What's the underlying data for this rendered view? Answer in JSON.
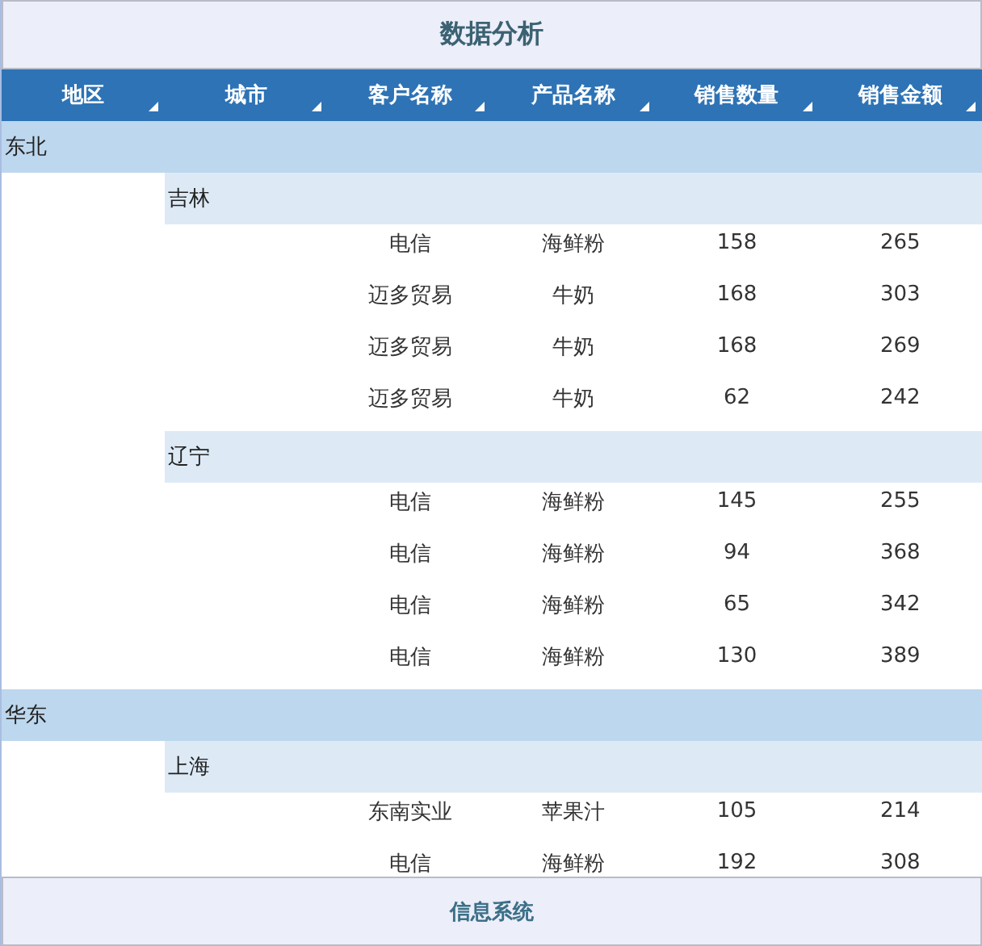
{
  "title": "数据分析",
  "columns": [
    "地区",
    "城市",
    "客户名称",
    "产品名称",
    "销售数量",
    "销售金额"
  ],
  "regions": [
    {
      "name": "东北",
      "children": [
        {
          "name": "吉林",
          "rows": [
            [
              "电信",
              "海鲜粉",
              "158",
              "265"
            ],
            [
              "迈多贸易",
              "牛奶",
              "168",
              "303"
            ],
            [
              "迈多贸易",
              "牛奶",
              "168",
              "269"
            ],
            [
              "迈多贸易",
              "牛奶",
              "62",
              "242"
            ]
          ]
        },
        {
          "name": "辽宁",
          "rows": [
            [
              "电信",
              "海鲜粉",
              "145",
              "255"
            ],
            [
              "电信",
              "海鲜粉",
              "94",
              "368"
            ],
            [
              "电信",
              "海鲜粉",
              "65",
              "342"
            ],
            [
              "电信",
              "海鲜粉",
              "130",
              "389"
            ]
          ]
        }
      ]
    },
    {
      "name": "华东",
      "children": [
        {
          "name": "上海",
          "rows": [
            [
              "东南实业",
              "苹果汁",
              "105",
              "214"
            ],
            [
              "电信",
              "海鲜粉",
              "192",
              "308"
            ]
          ]
        }
      ]
    }
  ],
  "footer": "信息系统"
}
